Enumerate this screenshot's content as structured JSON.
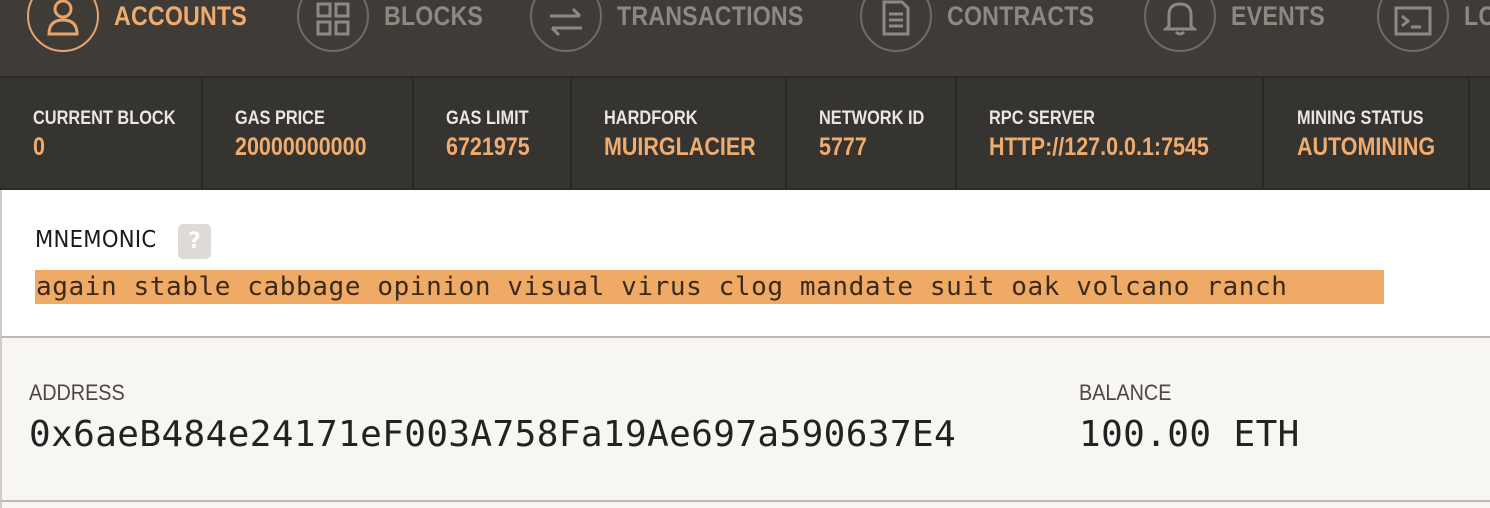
{
  "nav": {
    "items": [
      {
        "label": "ACCOUNTS",
        "icon": "user-icon",
        "active": true
      },
      {
        "label": "BLOCKS",
        "icon": "grid-icon",
        "active": false
      },
      {
        "label": "TRANSACTIONS",
        "icon": "swap-arrows-icon",
        "active": false
      },
      {
        "label": "CONTRACTS",
        "icon": "document-icon",
        "active": false
      },
      {
        "label": "EVENTS",
        "icon": "bell-icon",
        "active": false
      },
      {
        "label": "LO",
        "icon": "terminal-icon",
        "active": false
      }
    ]
  },
  "status": {
    "current_block": {
      "label": "CURRENT BLOCK",
      "value": "0"
    },
    "gas_price": {
      "label": "GAS PRICE",
      "value": "20000000000"
    },
    "gas_limit": {
      "label": "GAS LIMIT",
      "value": "6721975"
    },
    "hardfork": {
      "label": "HARDFORK",
      "value": "MUIRGLACIER"
    },
    "network_id": {
      "label": "NETWORK ID",
      "value": "5777"
    },
    "rpc_server": {
      "label": "RPC SERVER",
      "value": "HTTP://127.0.0.1:7545"
    },
    "mining_status": {
      "label": "MINING STATUS",
      "value": "AUTOMINING"
    }
  },
  "mnemonic": {
    "title": "MNEMONIC",
    "help": "?",
    "words": "again stable cabbage opinion visual virus clog mandate suit oak volcano ranch"
  },
  "account": {
    "address_label": "ADDRESS",
    "address": "0x6aeB484e24171eF003A758Fa19Ae697a590637E4",
    "balance_label": "BALANCE",
    "balance": "100.00 ETH"
  },
  "colors": {
    "accent": "#f0ab6e",
    "nav_bg": "#3f3c38",
    "status_bg": "#363431",
    "mnemonic_highlight": "#efab66"
  }
}
